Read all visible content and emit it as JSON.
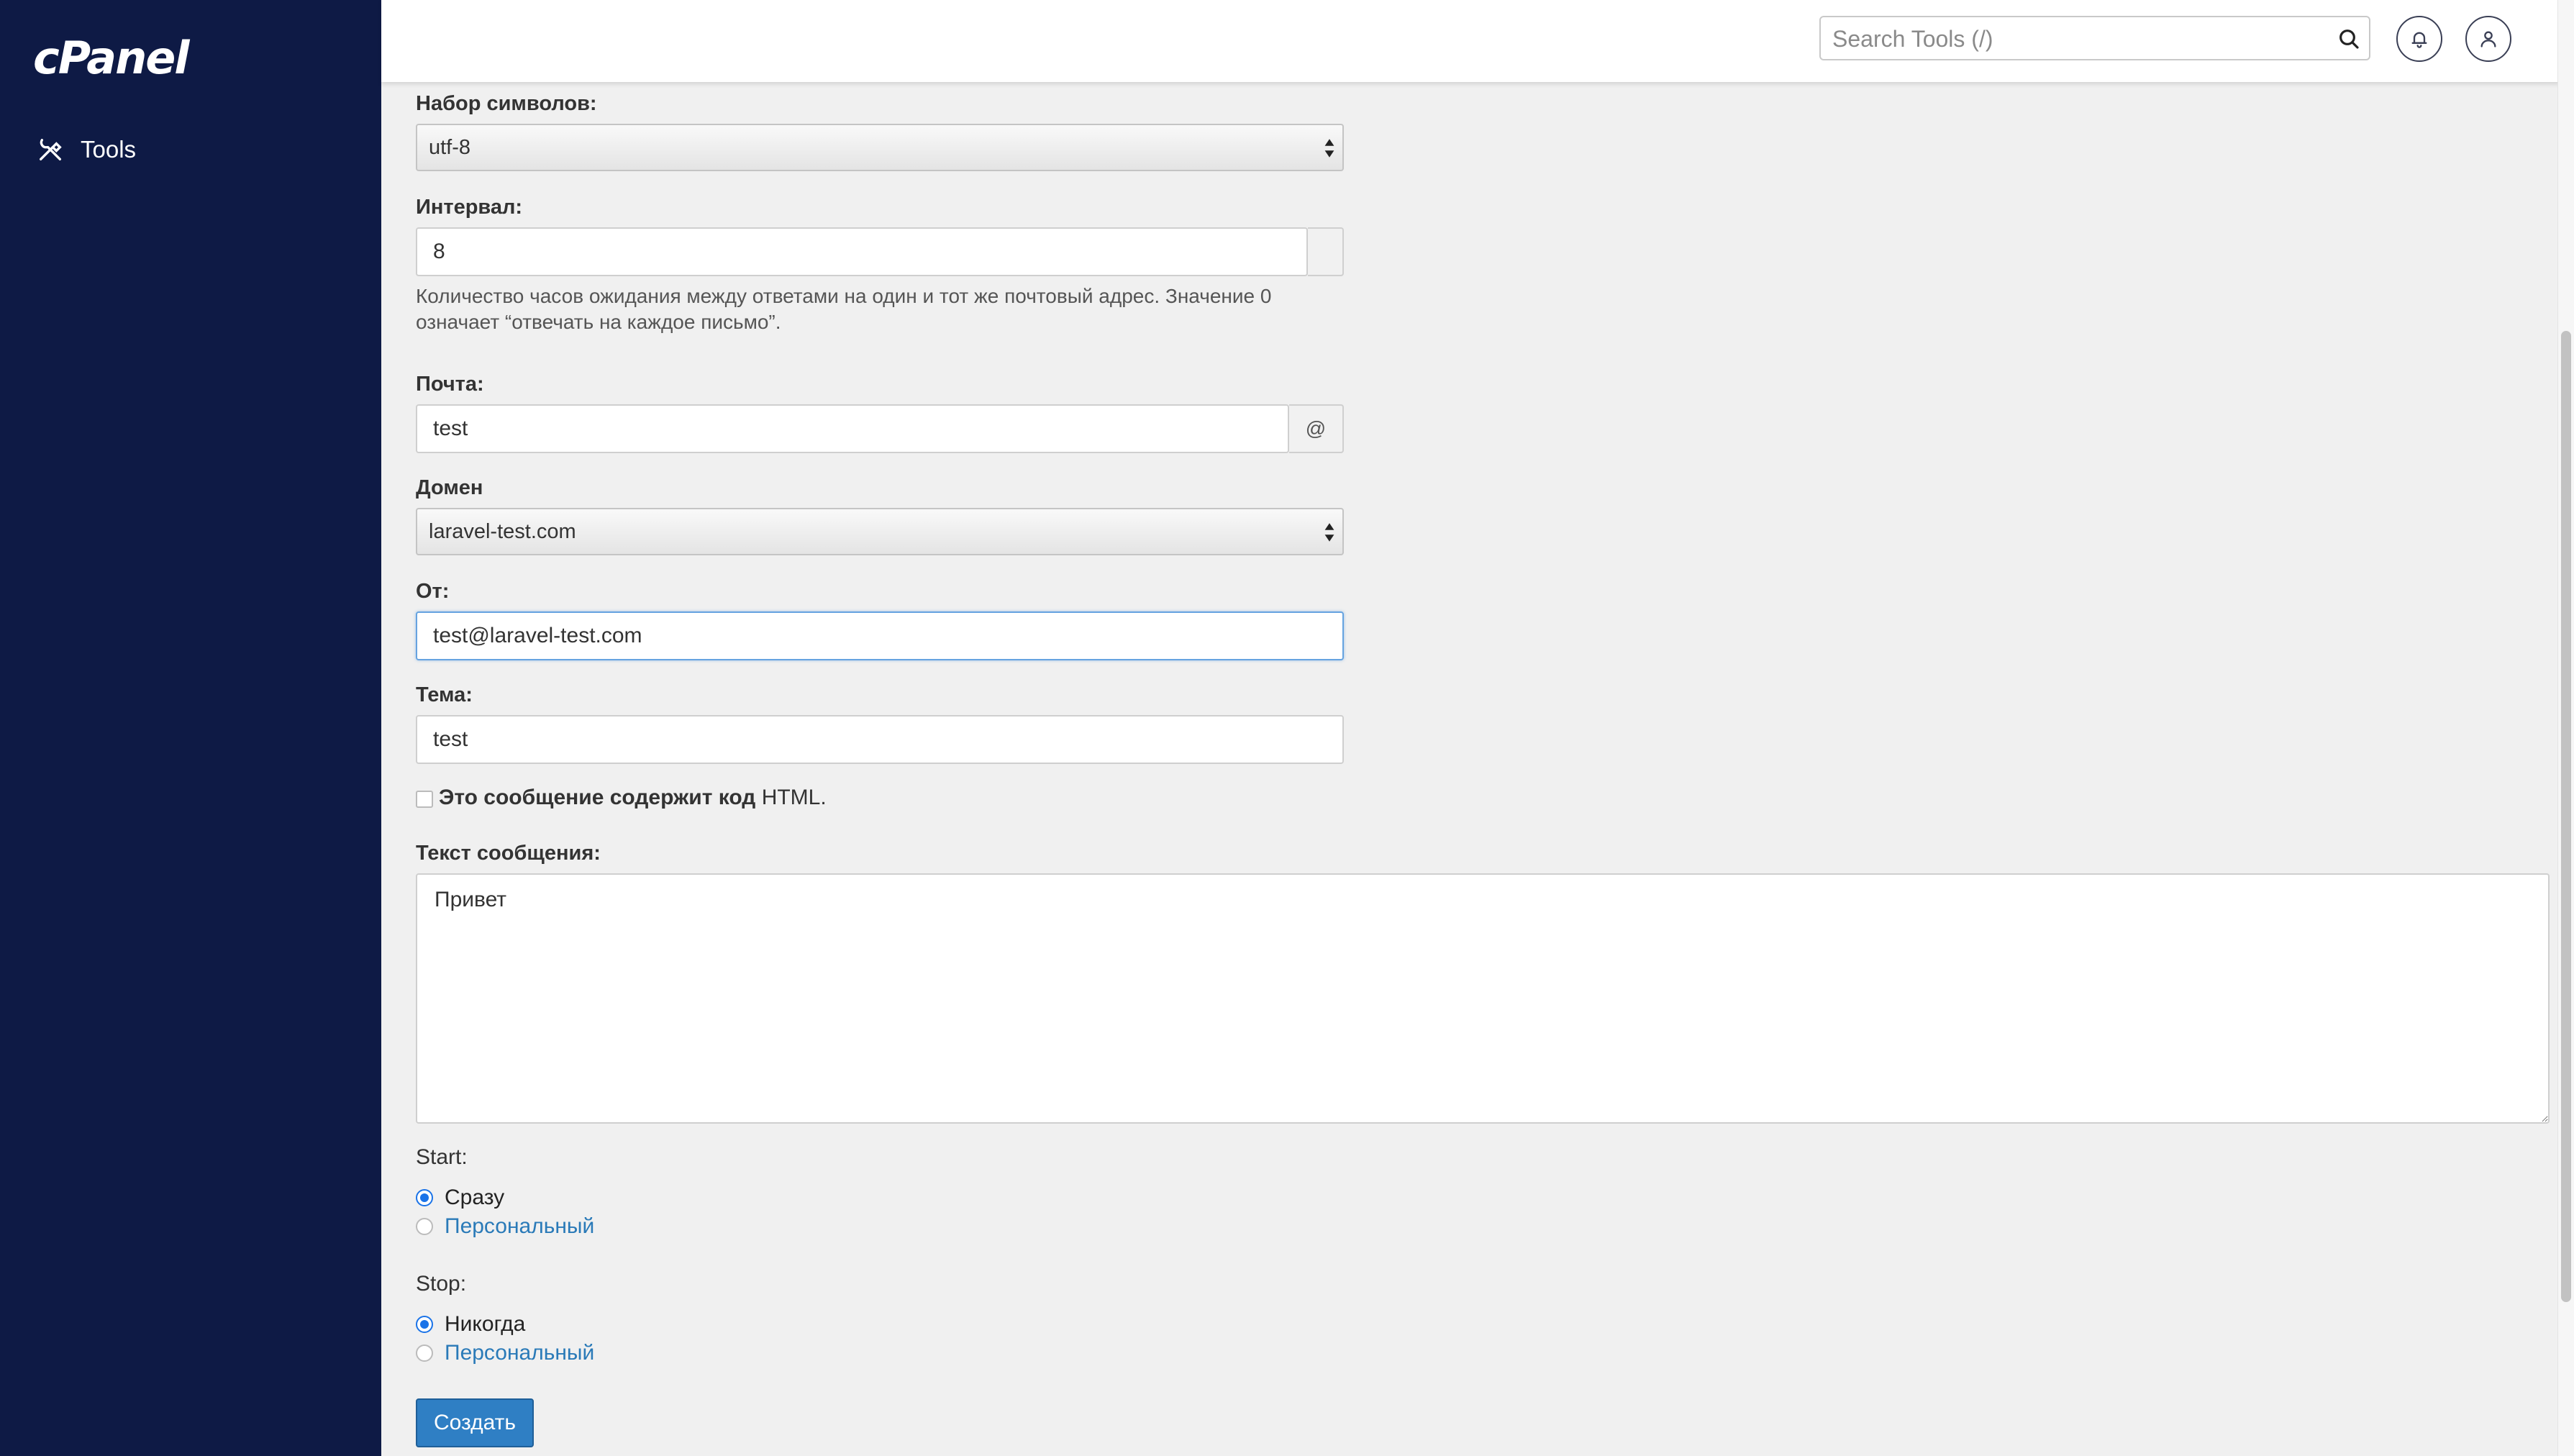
{
  "sidebar": {
    "logo": "cPanel",
    "items": [
      {
        "label": "Tools",
        "icon": "tools-icon"
      }
    ]
  },
  "header": {
    "search_placeholder": "Search Tools (/)",
    "notifications_icon": "bell-icon",
    "user_icon": "user-icon"
  },
  "form": {
    "charset": {
      "label": "Набор символов:",
      "value": "utf-8"
    },
    "interval": {
      "label": "Интервал:",
      "value": "8",
      "help_line1": "Количество часов ожидания между ответами на один и тот же почтовый адрес. Значение 0",
      "help_line2": "означает “отвечать на каждое письмо”."
    },
    "mail": {
      "label": "Почта:",
      "value": "test",
      "addon": "@"
    },
    "domain": {
      "label": "Домен",
      "value": "laravel-test.com"
    },
    "from": {
      "label": "От:",
      "value": "test@laravel-test.com"
    },
    "subject": {
      "label": "Тема:",
      "value": "test"
    },
    "html_checkbox": {
      "label_bold": "Это сообщение содержит код",
      "label_rest": " HTML.",
      "checked": false
    },
    "body": {
      "label": "Текст сообщения:",
      "value": "Привет"
    },
    "start": {
      "label": "Start:",
      "options": [
        "Сразу",
        "Персональный"
      ],
      "selected": "Сразу"
    },
    "stop": {
      "label": "Stop:",
      "options": [
        "Никогда",
        "Персональный"
      ],
      "selected": "Никогда"
    },
    "submit_label": "Создать"
  },
  "colors": {
    "sidebar_bg": "#0e1a45",
    "accent": "#2f7fc4",
    "link": "#2a7ab8"
  }
}
